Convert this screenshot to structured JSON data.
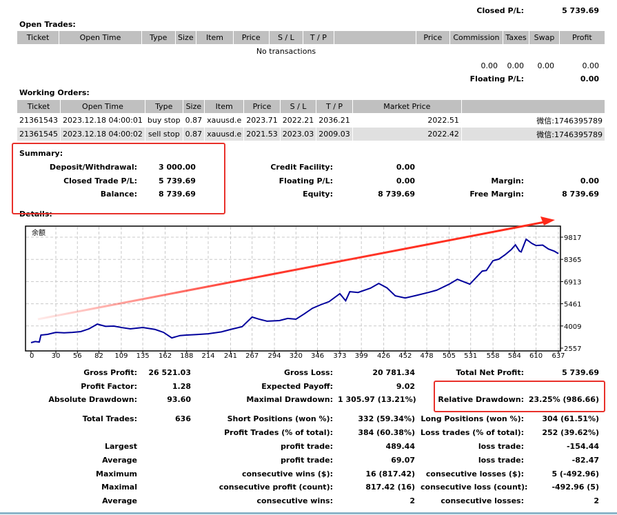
{
  "closed_pl": {
    "label": "Closed P/L:",
    "value": "5 739.69"
  },
  "open_trades": {
    "title": "Open Trades:",
    "columns": [
      "Ticket",
      "Open Time",
      "Type",
      "Size",
      "Item",
      "Price",
      "S / L",
      "T / P",
      "",
      "Price",
      "Commission",
      "Taxes",
      "Swap",
      "Profit"
    ],
    "empty_text": "No transactions",
    "totals": {
      "commission": "0.00",
      "taxes": "0.00",
      "swap": "0.00",
      "profit": "0.00"
    },
    "floating_pl": {
      "label": "Floating P/L:",
      "value": "0.00"
    }
  },
  "working_orders": {
    "title": "Working Orders:",
    "columns": [
      "Ticket",
      "Open Time",
      "Type",
      "Size",
      "Item",
      "Price",
      "S / L",
      "T / P",
      "Market Price",
      ""
    ],
    "rows": [
      {
        "ticket": "21361543",
        "open_time": "2023.12.18 04:00:01",
        "type": "buy stop",
        "size": "0.87",
        "item": "xauusd.e",
        "price": "2023.71",
        "sl": "2022.21",
        "tp": "2036.21",
        "market_price": "2022.51",
        "comment": "微信:1746395789"
      },
      {
        "ticket": "21361545",
        "open_time": "2023.12.18 04:00:02",
        "type": "sell stop",
        "size": "0.87",
        "item": "xauusd.e",
        "price": "2021.53",
        "sl": "2023.03",
        "tp": "2009.03",
        "market_price": "2022.42",
        "comment": "微信:1746395789"
      }
    ]
  },
  "summary": {
    "title": "Summary:",
    "deposit": {
      "label": "Deposit/Withdrawal:",
      "value": "3 000.00"
    },
    "closed_trade_pl": {
      "label": "Closed Trade P/L:",
      "value": "5 739.69"
    },
    "balance": {
      "label": "Balance:",
      "value": "8 739.69"
    },
    "credit": {
      "label": "Credit Facility:",
      "value": "0.00"
    },
    "floating_pl": {
      "label": "Floating P/L:",
      "value": "0.00"
    },
    "equity": {
      "label": "Equity:",
      "value": "8 739.69"
    },
    "margin": {
      "label": "Margin:",
      "value": "0.00"
    },
    "free_margin": {
      "label": "Free Margin:",
      "value": "8 739.69"
    }
  },
  "details": {
    "title": "Details:"
  },
  "chart_data": {
    "type": "line",
    "title": "余额",
    "xlabel": "",
    "ylabel": "",
    "x_ticks": [
      "0",
      "30",
      "56",
      "82",
      "109",
      "135",
      "162",
      "188",
      "214",
      "241",
      "267",
      "294",
      "320",
      "346",
      "373",
      "399",
      "426",
      "452",
      "478",
      "505",
      "531",
      "558",
      "584",
      "610",
      "637"
    ],
    "y_ticks": [
      "2557",
      "4009",
      "5461",
      "6913",
      "8365",
      "9817"
    ],
    "xlim": [
      0,
      637
    ],
    "ylim": [
      2557,
      9817
    ],
    "grid": true,
    "series": [
      {
        "name": "Balance",
        "color": "#00009c",
        "x": [
          0,
          5,
          10,
          12,
          20,
          30,
          40,
          50,
          60,
          70,
          80,
          90,
          100,
          110,
          120,
          135,
          150,
          160,
          170,
          180,
          188,
          200,
          214,
          230,
          241,
          255,
          267,
          275,
          285,
          300,
          310,
          320,
          330,
          340,
          350,
          360,
          373,
          380,
          385,
          395,
          410,
          420,
          430,
          440,
          452,
          465,
          480,
          490,
          505,
          515,
          525,
          530,
          545,
          550,
          558,
          565,
          573,
          580,
          585,
          590,
          592,
          598,
          605,
          610,
          618,
          625,
          632,
          637
        ],
        "y": [
          2917,
          2990,
          2960,
          3415,
          3460,
          3590,
          3560,
          3590,
          3640,
          3820,
          4130,
          3980,
          4000,
          3900,
          3820,
          3910,
          3780,
          3590,
          3230,
          3380,
          3415,
          3450,
          3500,
          3620,
          3780,
          3960,
          4590,
          4460,
          4320,
          4360,
          4500,
          4450,
          4800,
          5170,
          5400,
          5600,
          6120,
          5660,
          6250,
          6200,
          6480,
          6790,
          6500,
          5980,
          5840,
          6000,
          6200,
          6350,
          6740,
          7060,
          6850,
          6740,
          7600,
          7640,
          8280,
          8380,
          8680,
          9000,
          9310,
          8900,
          8850,
          9680,
          9400,
          9270,
          9300,
          9040,
          8900,
          8740
        ]
      }
    ],
    "annotation": "red arrow trending upward"
  },
  "stats": {
    "gross_profit": {
      "label": "Gross Profit:",
      "value": "26 521.03"
    },
    "gross_loss": {
      "label": "Gross Loss:",
      "value": "20 781.34"
    },
    "total_net_profit": {
      "label": "Total Net Profit:",
      "value": "5 739.69"
    },
    "profit_factor": {
      "label": "Profit Factor:",
      "value": "1.28"
    },
    "expected_payoff": {
      "label": "Expected Payoff:",
      "value": "9.02"
    },
    "absolute_drawdown": {
      "label": "Absolute Drawdown:",
      "value": "93.60"
    },
    "maximal_drawdown": {
      "label": "Maximal Drawdown:",
      "value": "1 305.97 (13.21%)"
    },
    "relative_drawdown": {
      "label": "Relative Drawdown:",
      "value": "23.25% (986.66)"
    },
    "total_trades": {
      "label": "Total Trades:",
      "value": "636"
    },
    "short_positions": {
      "label": "Short Positions (won %):",
      "value": "332 (59.34%)"
    },
    "long_positions": {
      "label": "Long Positions (won %):",
      "value": "304 (61.51%)"
    },
    "profit_trades": {
      "label": "Profit Trades (% of total):",
      "value": "384 (60.38%)"
    },
    "loss_trades": {
      "label": "Loss trades (% of total):",
      "value": "252 (39.62%)"
    },
    "largest": {
      "label": "Largest",
      "profit_label": "profit trade:",
      "profit_value": "489.44",
      "loss_label": "loss trade:",
      "loss_value": "-154.44"
    },
    "average": {
      "label": "Average",
      "profit_label": "profit trade:",
      "profit_value": "69.07",
      "loss_label": "loss trade:",
      "loss_value": "-82.47"
    },
    "maximum": {
      "label": "Maximum",
      "profit_label": "consecutive wins ($):",
      "profit_value": "16 (817.42)",
      "loss_label": "consecutive losses ($):",
      "loss_value": "5 (-492.96)"
    },
    "maximal": {
      "label": "Maximal",
      "profit_label": "consecutive profit (count):",
      "profit_value": "817.42 (16)",
      "loss_label": "consecutive loss (count):",
      "loss_value": "-492.96 (5)"
    },
    "average_consec": {
      "label": "Average",
      "profit_label": "consecutive wins:",
      "profit_value": "2",
      "loss_label": "consecutive losses:",
      "loss_value": "2"
    }
  },
  "colors": {
    "header_bg": "#c0c0c0",
    "alt_row": "#e0e0e0",
    "highlight_red": "#e8302a",
    "balance_line": "#00009c"
  }
}
